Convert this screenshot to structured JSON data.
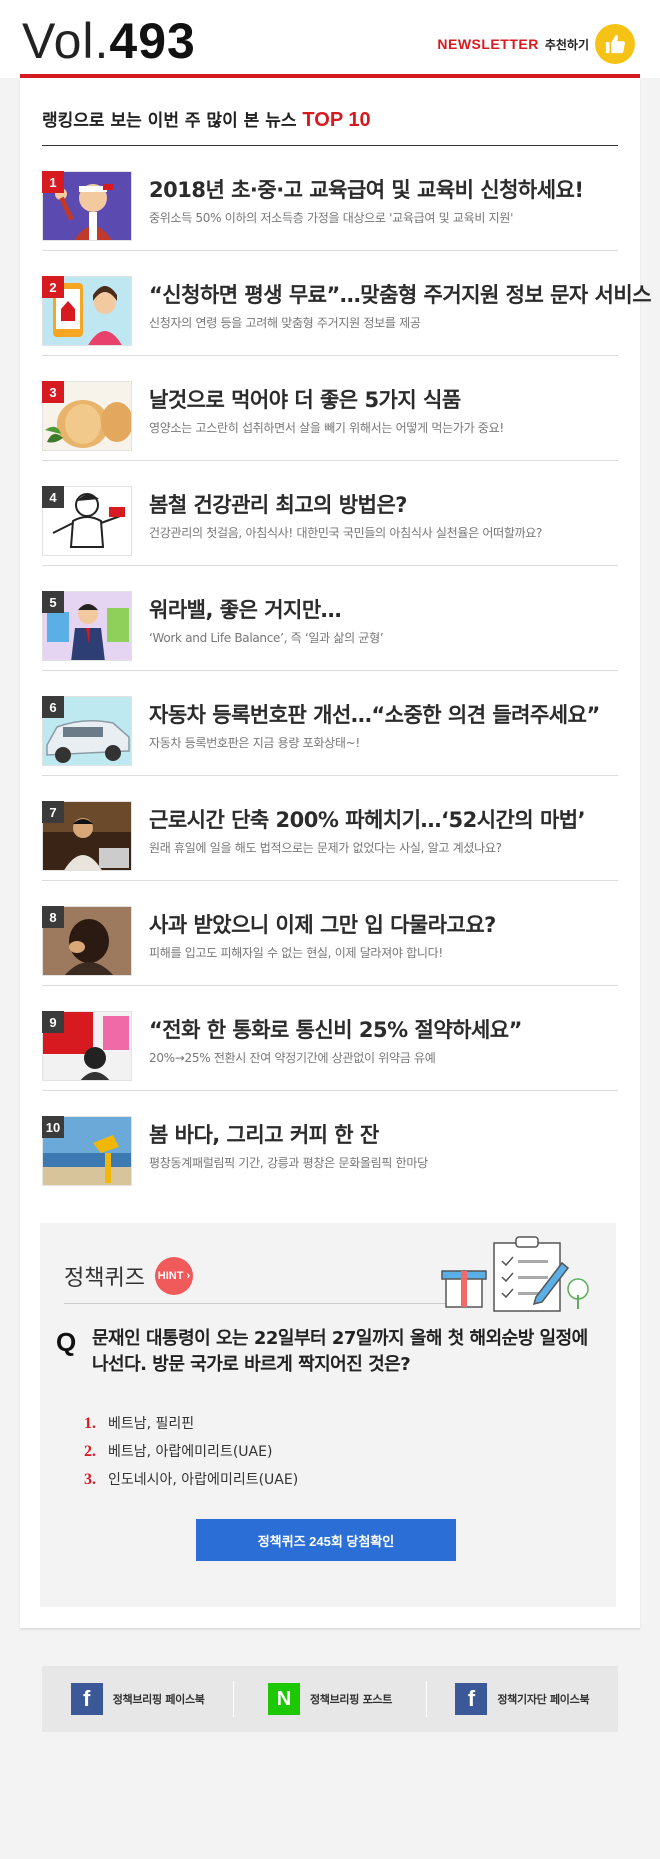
{
  "header": {
    "vol_label": "Vol.",
    "vol_number": "493",
    "newsletter_label": "NEWSLETTER",
    "recommend_label": "추천하기",
    "recommend_icon": "thumbs-up-icon"
  },
  "ranking": {
    "title_prefix": "랭킹으로 보는 이번 주 많이 본 뉴스",
    "title_highlight": "TOP 10",
    "items": [
      {
        "rank": "1",
        "title": "2018년 초·중·고 교육급여 및 교육비 신청하세요!",
        "desc": "중위소득 50% 이하의 저소득층 가정을 대상으로 '교육급여 및 교육비 지원'"
      },
      {
        "rank": "2",
        "title": "“신청하면 평생 무료”…맞춤형 주거지원 정보 문자 서비스",
        "desc": "신청자의 연령 등을 고려해 맞춤형 주거지원 정보를 제공"
      },
      {
        "rank": "3",
        "title": "날것으로 먹어야 더 좋은 5가지 식품",
        "desc": "영양소는 고스란히 섭취하면서 살을 빼기 위해서는 어떻게 먹는가가 중요!"
      },
      {
        "rank": "4",
        "title": "봄철 건강관리 최고의 방법은?",
        "desc": "건강관리의 첫걸음, 아침식사! 대한민국 국민들의 아침식사 실천율은 어떠할까요?"
      },
      {
        "rank": "5",
        "title": "워라밸, 좋은 거지만…",
        "desc": "‘Work and Life Balance’, 즉 ‘일과 삶의 균형’"
      },
      {
        "rank": "6",
        "title": "자동차 등록번호판 개선…“소중한 의견 들려주세요”",
        "desc": "자동차 등록번호판은 지금 용량 포화상태~!"
      },
      {
        "rank": "7",
        "title": "근로시간 단축 200% 파헤치기…‘52시간의 마법’",
        "desc": "원래 휴일에 일을 해도 법적으로는 문제가 없었다는 사실, 알고 계셨나요?"
      },
      {
        "rank": "8",
        "title": "사과 받았으니 이제 그만 입 다물라고요?",
        "desc": "피해를 입고도 피해자일 수 없는 현실, 이제 달라져야 합니다!"
      },
      {
        "rank": "9",
        "title": "“전화 한 통화로 통신비 25% 절약하세요”",
        "desc": "20%→25% 전환시 잔여 약정기간에 상관없이 위약금 유예"
      },
      {
        "rank": "10",
        "title": "봄 바다, 그리고 커피 한 잔",
        "desc": "평창동계패럴림픽 기간, 강릉과 평창은 문화올림픽 한마당"
      }
    ]
  },
  "quiz": {
    "title": "정책퀴즈",
    "hint_label": "HINT",
    "q_mark": "Q",
    "question": "문재인 대통령이 오는 22일부터 27일까지 올해 첫 해외순방 일정에 나선다. 방문 국가로 바르게 짝지어진 것은?",
    "options": [
      {
        "num": "1.",
        "text": "베트남, 필리핀"
      },
      {
        "num": "2.",
        "text": "베트남, 아랍에미리트(UAE)"
      },
      {
        "num": "3.",
        "text": "인도네시아, 아랍에미리트(UAE)"
      }
    ],
    "button_label": "정책퀴즈 245회 당첨확인"
  },
  "footer": {
    "links": [
      {
        "icon": "facebook-icon",
        "glyph": "f",
        "label": "정책브리핑 페이스북"
      },
      {
        "icon": "naver-icon",
        "glyph": "N",
        "label": "정책브리핑 포스트"
      },
      {
        "icon": "facebook-icon",
        "glyph": "f",
        "label": "정책기자단 페이스북"
      }
    ]
  },
  "colors": {
    "accent_red": "#d71920",
    "button_blue": "#2b6fd6",
    "facebook_blue": "#3b5998",
    "naver_green": "#1ec800",
    "thumb_yellow": "#f5c316"
  }
}
